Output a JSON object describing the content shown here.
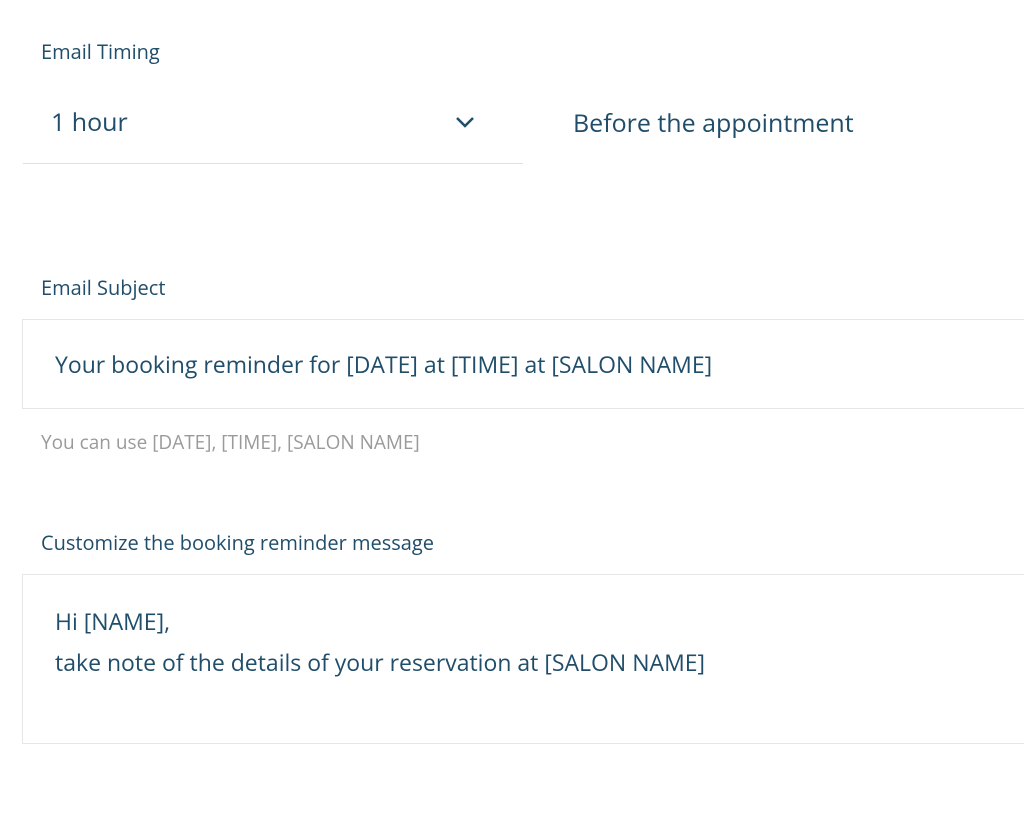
{
  "timing": {
    "label": "Email Timing",
    "value": "1 hour",
    "suffix": "Before the appointment"
  },
  "subject": {
    "label": "Email Subject",
    "value": "Your booking reminder for [DATE] at [TIME] at [SALON NAME]",
    "help": "You can use [DATE], [TIME], [SALON NAME]"
  },
  "message": {
    "label": "Customize the booking reminder message",
    "value": "Hi [NAME],\ntake note of the details of your reservation at [SALON NAME]"
  }
}
